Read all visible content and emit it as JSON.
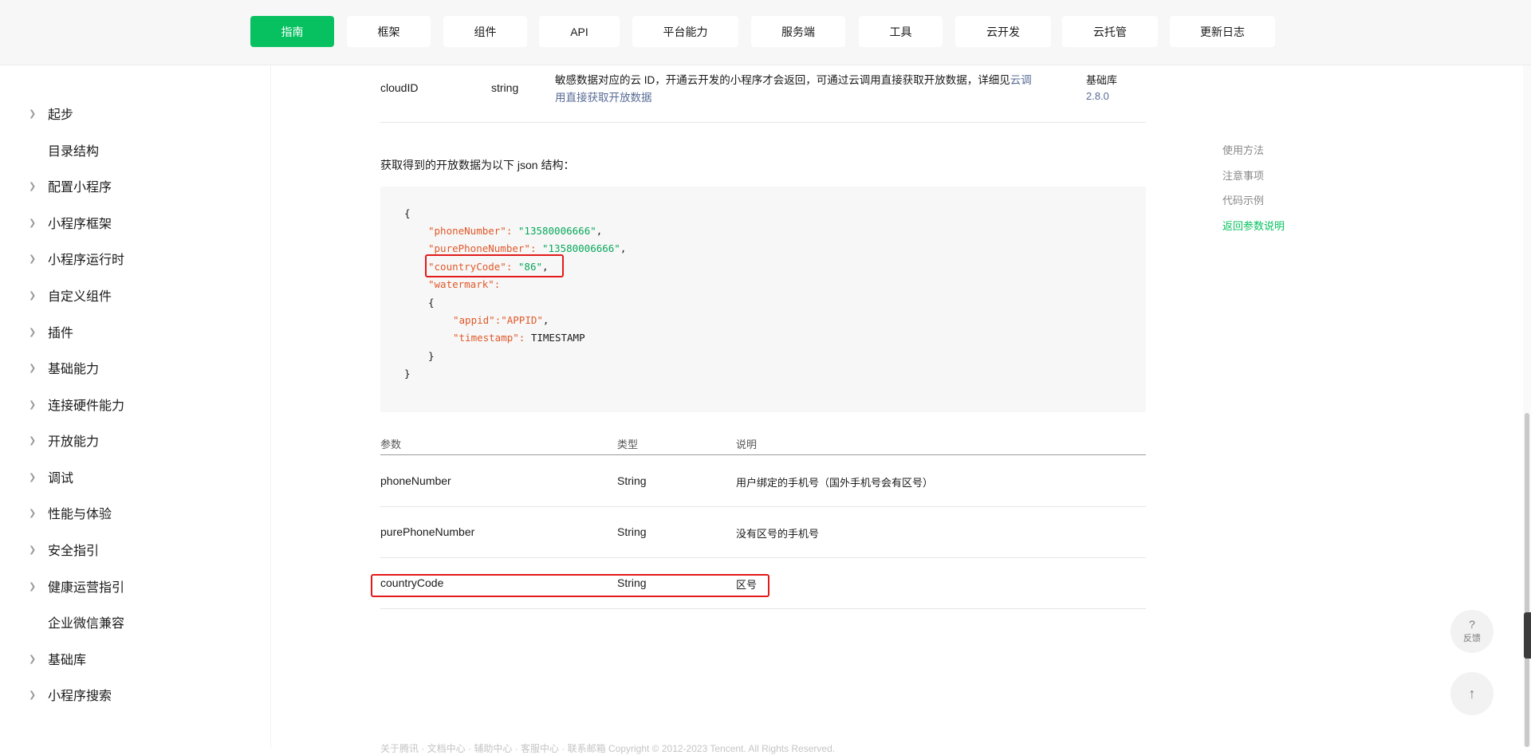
{
  "nav": {
    "items": [
      {
        "label": "指南",
        "active": true
      },
      {
        "label": "框架"
      },
      {
        "label": "组件"
      },
      {
        "label": "API"
      },
      {
        "label": "平台能力"
      },
      {
        "label": "服务端"
      },
      {
        "label": "工具"
      },
      {
        "label": "云开发"
      },
      {
        "label": "云托管"
      },
      {
        "label": "更新日志"
      }
    ],
    "accent_color": "#07c160"
  },
  "sidebar": {
    "items": [
      {
        "label": "起步",
        "expandable": true
      },
      {
        "label": "目录结构",
        "expandable": false
      },
      {
        "label": "配置小程序",
        "expandable": true
      },
      {
        "label": "小程序框架",
        "expandable": true
      },
      {
        "label": "小程序运行时",
        "expandable": true
      },
      {
        "label": "自定义组件",
        "expandable": true
      },
      {
        "label": "插件",
        "expandable": true
      },
      {
        "label": "基础能力",
        "expandable": true
      },
      {
        "label": "连接硬件能力",
        "expandable": true
      },
      {
        "label": "开放能力",
        "expandable": true
      },
      {
        "label": "调试",
        "expandable": true
      },
      {
        "label": "性能与体验",
        "expandable": true
      },
      {
        "label": "安全指引",
        "expandable": true
      },
      {
        "label": "健康运营指引",
        "expandable": true
      },
      {
        "label": "企业微信兼容",
        "expandable": false
      },
      {
        "label": "基础库",
        "expandable": true
      },
      {
        "label": "小程序搜索",
        "expandable": true
      }
    ]
  },
  "main": {
    "cloud_row": {
      "name": "cloudID",
      "type": "string",
      "desc_prefix": "敏感数据对应的云 ID，开通云开发的小程序才会返回，可通过云调用直接获取开放数据，详细见",
      "desc_link_1": "云调",
      "desc_link_2": "用直接获取开放数据",
      "version_label": "基础库",
      "version": "2.8.0"
    },
    "intro": "获取得到的开放数据为以下 json 结构：",
    "code": {
      "open_brace": "{",
      "k_phone": "\"phoneNumber\"",
      "v_phone": "\"13580006666\"",
      "k_pure": "\"purePhoneNumber\"",
      "v_pure": "\"13580006666\"",
      "k_country": "\"countryCode\"",
      "v_country": "\"86\"",
      "k_watermark": "\"watermark\"",
      "inner_open": "{",
      "k_appid": "\"appid\"",
      "v_appid": "\"APPID\"",
      "k_timestamp": "\"timestamp\"",
      "v_timestamp": "TIMESTAMP",
      "inner_close": "}",
      "close_brace": "}",
      "colon": ": ",
      "colon_tight": ":",
      "comma": ","
    },
    "table": {
      "headers": [
        "参数",
        "类型",
        "说明"
      ],
      "rows": [
        {
          "name": "phoneNumber",
          "type": "String",
          "desc": "用户绑定的手机号（国外手机号会有区号）"
        },
        {
          "name": "purePhoneNumber",
          "type": "String",
          "desc": "没有区号的手机号"
        },
        {
          "name": "countryCode",
          "type": "String",
          "desc": "区号"
        }
      ]
    },
    "footer": "关于腾讯 · 文档中心 · 辅助中心 · 客服中心 · 联系邮箱                                          Copyright © 2012-2023 Tencent. All Rights Reserved."
  },
  "toc": {
    "items": [
      "使用方法",
      "注意事项",
      "代码示例",
      "返回参数说明"
    ],
    "active_index": 3
  },
  "float": {
    "feedback_mark": "?",
    "feedback_label": "反馈",
    "top_icon": "↑"
  },
  "icons": [
    "chevron-right-icon",
    "feedback-icon",
    "back-to-top-icon"
  ],
  "highlight_color": "#e21a1a"
}
